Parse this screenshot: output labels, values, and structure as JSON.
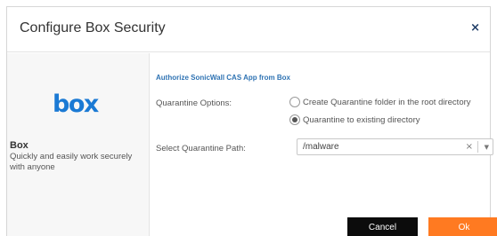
{
  "dialog": {
    "title": "Configure Box Security",
    "close_icon": "×"
  },
  "sidebar": {
    "logo_text": "box",
    "app_name": "Box",
    "app_description": "Quickly and easily work securely with anyone"
  },
  "main": {
    "authorize_link": "Authorize SonicWall CAS App from Box",
    "quarantine_options_label": "Quarantine Options:",
    "options": [
      {
        "label": "Create Quarantine folder in the root directory",
        "selected": false
      },
      {
        "label": "Quarantine to existing directory",
        "selected": true
      }
    ],
    "path_label": "Select Quarantine Path:",
    "path_value": "/malware",
    "clear_icon": "×",
    "dropdown_icon": "▼"
  },
  "buttons": {
    "cancel_label": "Cancel",
    "ok_label": "Ok"
  },
  "colors": {
    "accent_link": "#2f73b3",
    "ok_button": "#ff7a21",
    "cancel_button": "#0c0c0c",
    "box_logo": "#1b7ad4"
  }
}
